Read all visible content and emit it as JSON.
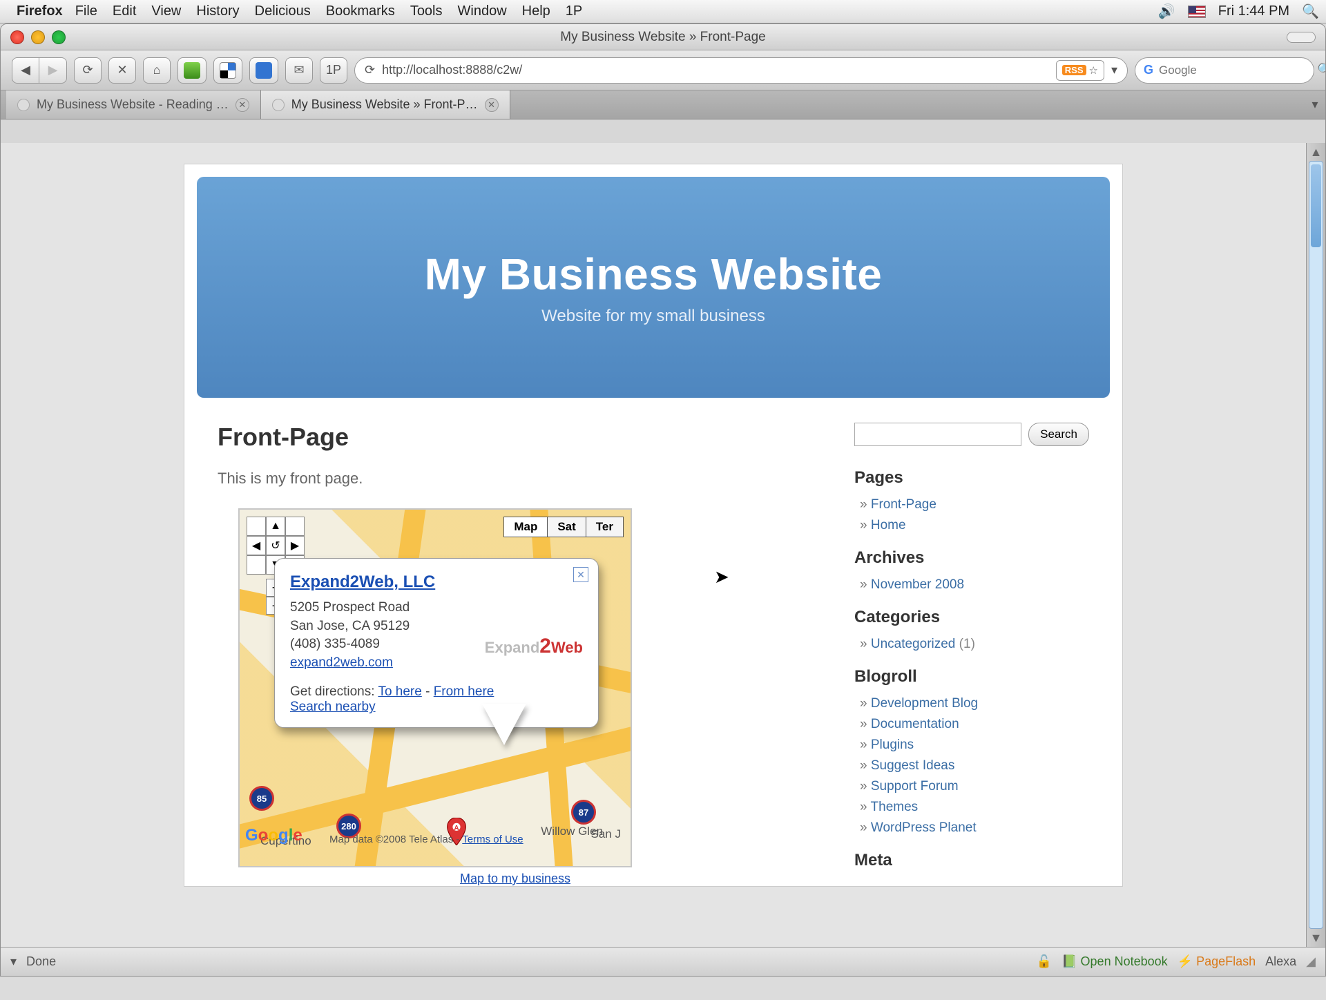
{
  "mac_menu": {
    "app": "Firefox",
    "items": [
      "File",
      "Edit",
      "View",
      "History",
      "Delicious",
      "Bookmarks",
      "Tools",
      "Window",
      "Help",
      "1P"
    ],
    "clock": "Fri 1:44 PM"
  },
  "window": {
    "title": "My Business Website » Front-Page"
  },
  "toolbar": {
    "back": "◀",
    "forward": "▶",
    "reload": "⟳",
    "stop": "✕",
    "home": "⌂",
    "onep": "1P",
    "url_prefix": "⟳",
    "url": "http://localhost:8888/c2w/",
    "rss": "RSS",
    "star": "☆",
    "dropdown": "▾",
    "search_icon": "G",
    "search_placeholder": "Google",
    "search_mag": "🔍"
  },
  "tabs": [
    {
      "label": "My Business Website - Reading …",
      "active": false
    },
    {
      "label": "My Business Website » Front-P…",
      "active": true
    }
  ],
  "page": {
    "site_title": "My Business Website",
    "tagline": "Website for my small business",
    "post_title": "Front-Page",
    "post_body": "This is my front page.",
    "map_caption": "Map to my business"
  },
  "map": {
    "types": [
      "Map",
      "Sat",
      "Ter"
    ],
    "controls": {
      "up": "▲",
      "down": "▼",
      "left": "◀",
      "right": "▶",
      "center": "↺",
      "plus": "+",
      "minus": "−"
    },
    "shields": {
      "i280": "280",
      "hw85": "85",
      "hw87": "87"
    },
    "cities": {
      "cupertino": "Cupertino",
      "sanjose": "San J",
      "willow": "Willow Glen"
    },
    "info": {
      "title": "Expand2Web, LLC",
      "addr1": "5205 Prospect Road",
      "addr2": "San Jose, CA 95129",
      "phone": "(408) 335-4089",
      "site": "expand2web.com",
      "logo_a": "Expand",
      "logo_2": "2",
      "logo_b": "Web",
      "dirs_label": "Get directions:",
      "to_here": "To here",
      "sep": " - ",
      "from_here": "From here",
      "search_nearby": "Search nearby"
    },
    "attribution": "Map data ©2008 Tele Atlas - ",
    "terms": "Terms of Use"
  },
  "sidebar": {
    "search_btn": "Search",
    "pages_h": "Pages",
    "pages": [
      "Front-Page",
      "Home"
    ],
    "archives_h": "Archives",
    "archives": [
      "November 2008"
    ],
    "categories_h": "Categories",
    "cat_item": "Uncategorized",
    "cat_count": "(1)",
    "blogroll_h": "Blogroll",
    "blogroll": [
      "Development Blog",
      "Documentation",
      "Plugins",
      "Suggest Ideas",
      "Support Forum",
      "Themes",
      "WordPress Planet"
    ],
    "meta_h": "Meta"
  },
  "status": {
    "done": "Done",
    "notebook": "Open Notebook",
    "pageflash": "PageFlash",
    "alexa": "Alexa"
  }
}
